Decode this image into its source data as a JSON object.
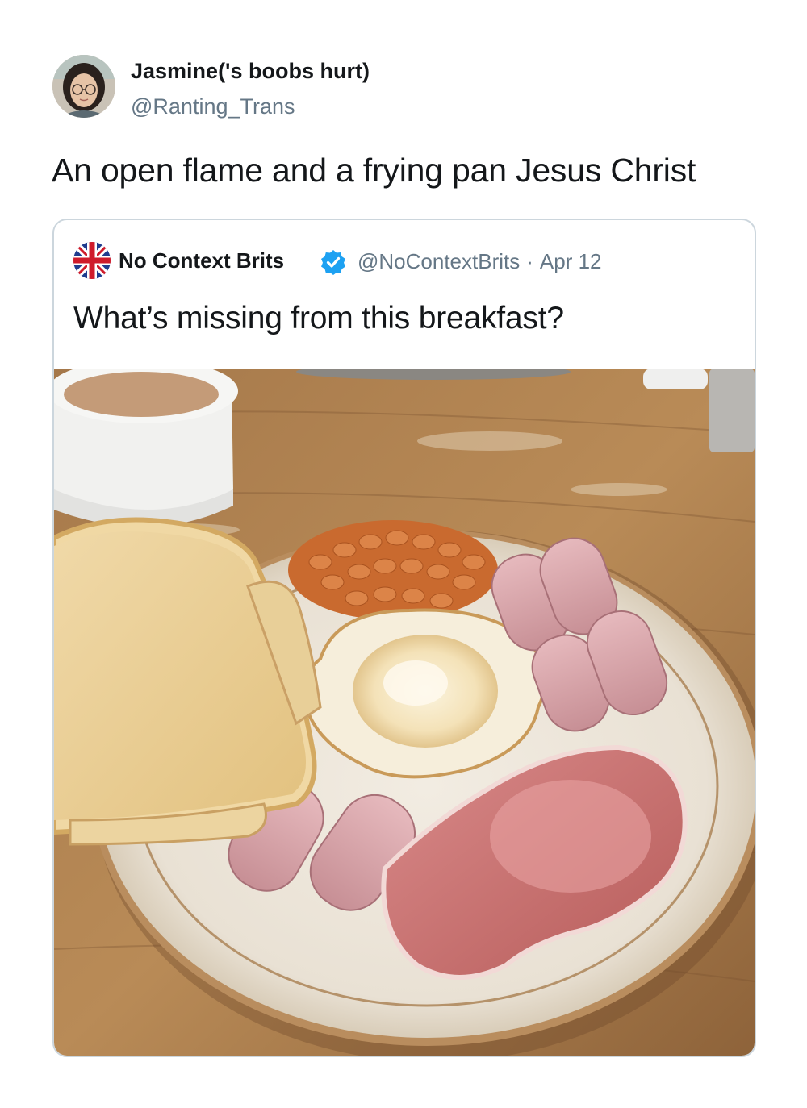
{
  "tweet": {
    "author": {
      "display_name": "Jasmine('s boobs hurt)",
      "handle": "@Ranting_Trans",
      "avatar_icon": "profile-photo"
    },
    "text": "An open flame and a frying pan Jesus Christ"
  },
  "quoted_tweet": {
    "author": {
      "display_name": "No Context Brits",
      "handle": "@NoContextBrits",
      "verified": true,
      "avatar_icon": "union-jack-avatar"
    },
    "separator": "·",
    "date": "Apr 12",
    "text": "What’s missing from this breakfast?",
    "media": {
      "type": "photo",
      "subject": "breakfast plate"
    }
  },
  "colors": {
    "text_primary": "#14171a",
    "text_secondary": "#657786",
    "card_border": "#ccd6dd",
    "verified_blue": "#1da1f2"
  }
}
